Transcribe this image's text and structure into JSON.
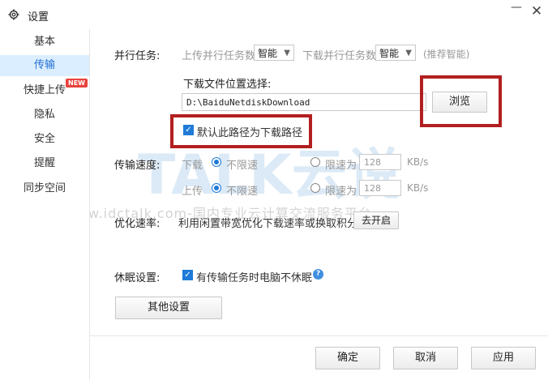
{
  "window": {
    "title": "设置",
    "minimize_glyph": "—",
    "close_glyph": "✕"
  },
  "sidebar": {
    "items": [
      {
        "label": "基本"
      },
      {
        "label": "传输",
        "active": true
      },
      {
        "label": "快捷上传",
        "badge": "NEW"
      },
      {
        "label": "隐私"
      },
      {
        "label": "安全"
      },
      {
        "label": "提醒"
      },
      {
        "label": "同步空间"
      }
    ]
  },
  "parallel": {
    "label": "并行任务:",
    "upload_label": "上传并行任务数",
    "upload_value": "智能",
    "download_label": "下载并行任务数",
    "download_value": "智能",
    "hint": "(推荐智能)"
  },
  "download_location": {
    "label": "下载文件位置选择:",
    "path": "D:\\BaiduNetdiskDownload",
    "browse_label": "浏览",
    "default_checkbox_label": "默认此路径为下载路径",
    "default_checked": true
  },
  "speed": {
    "label": "传输速度:",
    "download_label": "下载",
    "upload_label": "上传",
    "unlimited_label": "不限速",
    "limit_label": "限速为",
    "download_limit_value": "128",
    "upload_limit_value": "128",
    "unit": "KB/s",
    "download_unlimited": true,
    "upload_unlimited": true
  },
  "optimize": {
    "label": "优化速率:",
    "text": "利用闲置带宽优化下载速率或换取积分",
    "button_label": "去开启"
  },
  "sleep": {
    "label": "休眠设置:",
    "checkbox_label": "有传输任务时电脑不休眠",
    "checked": true,
    "help_glyph": "?"
  },
  "other_settings_label": "其他设置",
  "footer": {
    "ok_label": "确定",
    "cancel_label": "取消",
    "apply_label": "应用"
  },
  "watermark": {
    "brand": "TALK云说",
    "url": "-www.idctalk.com-国内专业云计算交流服务平台-"
  },
  "colors": {
    "accent": "#1f7ad8",
    "highlight_box": "#b21f1f",
    "sidebar_active_bg": "#dbeeff"
  },
  "icons": {
    "title": "gear-icon",
    "help": "question-circle-icon"
  }
}
